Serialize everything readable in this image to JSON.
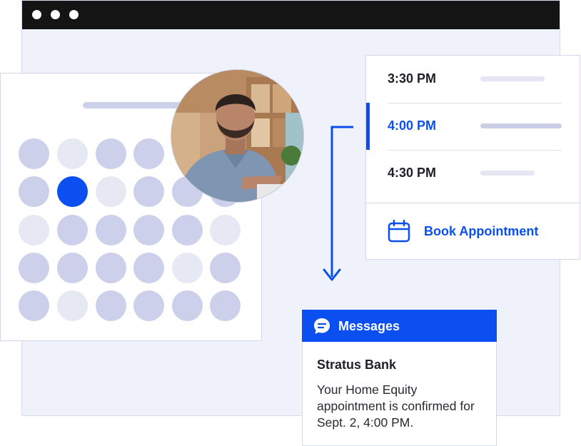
{
  "window": {
    "title_bar_dots": 3
  },
  "avatar": {
    "description_icon": "person-photo"
  },
  "schedule": {
    "slots": [
      {
        "time": "3:30 PM",
        "selected": false
      },
      {
        "time": "4:00 PM",
        "selected": true
      },
      {
        "time": "4:30 PM",
        "selected": false
      }
    ],
    "book_button_label": "Book Appointment",
    "book_icon": "calendar-icon"
  },
  "messages": {
    "header_label": "Messages",
    "header_icon": "chat-bubble-icon",
    "sender": "Stratus Bank",
    "body": "Your Home Equity appointment is confirmed for Sept. 2, 4:00 PM."
  },
  "colors": {
    "accent": "#0b4ff0",
    "title_bar": "#141414",
    "window_bg": "#eff1fb",
    "calendar_day": "#ccd0ea",
    "calendar_day_light": "#e6e8f4"
  }
}
